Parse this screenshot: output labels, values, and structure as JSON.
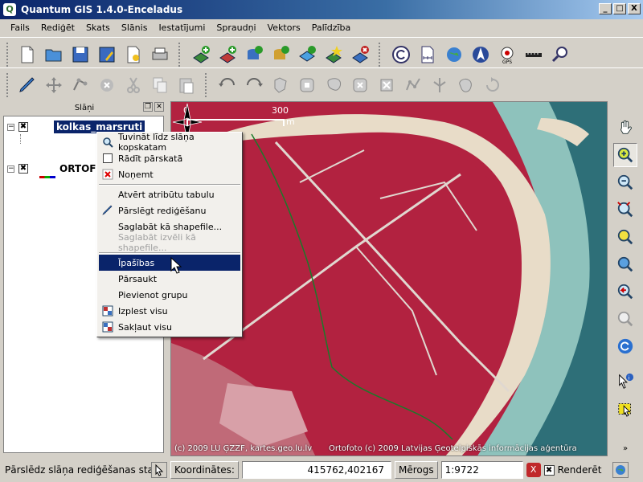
{
  "window": {
    "title": "Quantum GIS 1.4.0-Enceladus",
    "app_icon": "Q",
    "controls": [
      "_",
      "□",
      "X"
    ]
  },
  "menubar": [
    "Fails",
    "Rediģēt",
    "Skats",
    "Slānis",
    "Iestatījumi",
    "Spraudņi",
    "Vektors",
    "Palīdzība"
  ],
  "layers_panel": {
    "title": "Slāņi",
    "layers": [
      {
        "name": "kolkas_marsruti",
        "checked": "✖",
        "selected": true
      },
      {
        "name": "ORTOFO",
        "checked": "✖",
        "selected": false
      }
    ]
  },
  "map": {
    "scale_labels": {
      "zero": "0",
      "end": "300",
      "unit": "m"
    },
    "copyright_left": "(c) 2009 LU ĢZZF, kartes.geo.lu.lv",
    "copyright_right": "Ortofoto (c) 2009 Latvijas Ģeotelpiskās informācijas aģentūra",
    "colors": {
      "forest": "#b22240",
      "sand": "#e8dcc8",
      "sea": "#2e6f78",
      "route": "#1a7a2a"
    }
  },
  "context_menu": {
    "items": [
      {
        "label": "Tuvināt līdz slāņa kopskatam",
        "icon": "zoom-to-layer-icon"
      },
      {
        "label": "Rādīt pārskatā",
        "icon": "checkbox-icon"
      },
      {
        "label": "Noņemt",
        "icon": "remove-icon"
      },
      {
        "label": "Atvērt atribūtu tabulu",
        "icon": ""
      },
      {
        "label": "Pārslēgt rediģēšanu",
        "icon": "pencil-icon"
      },
      {
        "label": "Saglabāt kā shapefile...",
        "icon": ""
      },
      {
        "label": "Saglabāt izvēli kā shapefile...",
        "icon": "",
        "disabled": true
      },
      {
        "label": "Īpašības",
        "icon": "",
        "hover": true
      },
      {
        "label": "Pārsaukt",
        "icon": ""
      },
      {
        "label": "Pievienot grupu",
        "icon": ""
      },
      {
        "label": "Izplest visu",
        "icon": "expand-all-icon"
      },
      {
        "label": "Sakļaut visu",
        "icon": "collapse-all-icon"
      }
    ]
  },
  "statusbar": {
    "message": "Pārslēdz slāņa rediģēšanas stat",
    "coords_label": "Koordinātes:",
    "coords_value": "415762,402167",
    "scale_label": "Mērogs",
    "scale_value": "1:9722",
    "stop_icon": "X",
    "render_checked": "✖",
    "render_label": "Renderēt"
  }
}
